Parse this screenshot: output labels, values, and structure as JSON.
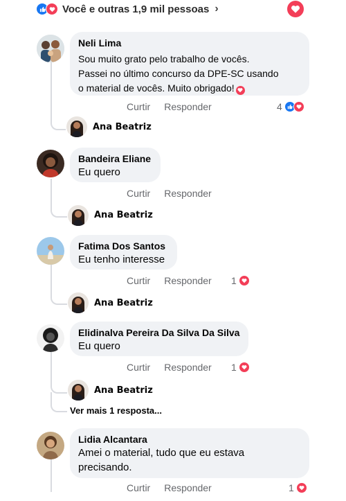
{
  "summary": {
    "text": "Você e outras 1,9 mil pessoas",
    "chevron": "›"
  },
  "actions": {
    "like_label": "Curtir",
    "reply_label": "Responder"
  },
  "comments": [
    {
      "author": "Neli Lima",
      "text_lines": [
        "Sou muito grato pelo trabalho de vocês.",
        "Passei no último concurso da DPE-SC usando",
        "o material de vocês. Muito obrigado!"
      ],
      "reaction_count": "4",
      "reaction_icons": [
        "like-icon",
        "love-icon"
      ],
      "reply_author": "Ana Beatriz"
    },
    {
      "author": "Bandeira Eliane",
      "text": "Eu quero",
      "reaction_count": "",
      "reply_author": "Ana Beatriz"
    },
    {
      "author": "Fatima Dos Santos",
      "text": "Eu tenho interesse",
      "reaction_count": "1",
      "reaction_icons": [
        "love-icon"
      ],
      "reply_author": "Ana Beatriz"
    },
    {
      "author": "Elidinalva Pereira Da Silva Da Silva",
      "text": "Eu quero",
      "reaction_count": "1",
      "reaction_icons": [
        "love-icon"
      ],
      "reply_author": "Ana Beatriz",
      "more_replies": "Ver mais 1 resposta..."
    },
    {
      "author": "Lidia Alcantara",
      "text_lines": [
        "Amei o material, tudo que eu estava",
        "precisando."
      ],
      "reaction_count": "1",
      "reaction_icons": [
        "love-icon"
      ]
    }
  ],
  "colors": {
    "bubble": "#f0f2f5",
    "like": "#1877f2",
    "love": "#f33e58",
    "meta_text": "#65676b"
  }
}
